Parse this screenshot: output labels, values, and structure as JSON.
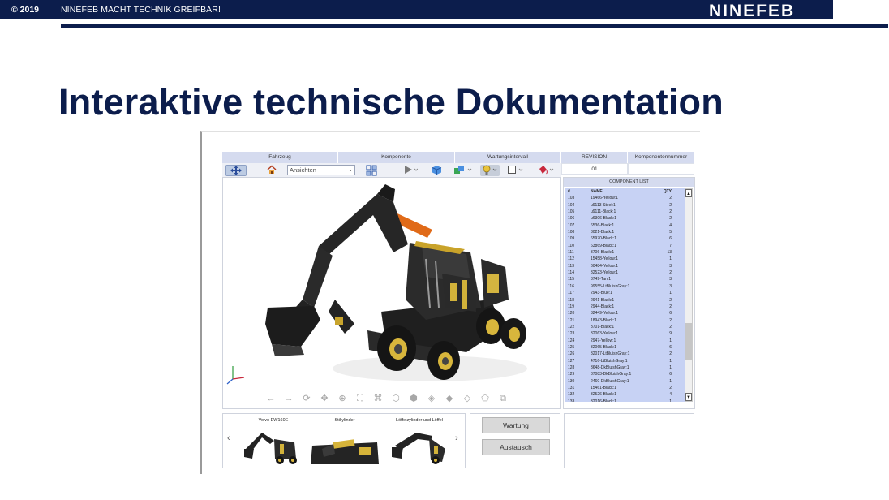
{
  "slide": {
    "copyright": "© 2019",
    "tagline": "NINEFEB MACHT TECHNIK GREIFBAR!",
    "logo": "NINEFEB",
    "title": "Interaktive technische Dokumentation"
  },
  "colors": {
    "navy": "#0c1d4c",
    "list_bg": "#c7d2f4",
    "header_bg": "#d5dbef"
  },
  "app": {
    "header_left": [
      "Fahrzeug",
      "Komponente",
      "Wartungsintervall"
    ],
    "header_right": {
      "revision_label": "REVISION",
      "revision_value": "01",
      "component_number_label": "Komponentennummer",
      "component_number_value": ""
    },
    "toolbar": {
      "views_select_value": "Ansichten",
      "icons": [
        "navigate-cube-icon",
        "home-icon",
        "explode-view-icon",
        "play-icon",
        "cube-icon",
        "colored-cubes-icon",
        "light-bulb-icon",
        "color-square-icon",
        "paint-bucket-icon"
      ]
    },
    "viewer_tools": [
      "arrow-left-icon",
      "arrow-right-icon",
      "rotate-icon",
      "pan-icon",
      "zoom-window-icon",
      "fit-all-icon",
      "select-tree-icon",
      "view-front-icon",
      "view-top-icon",
      "view-side-icon",
      "shaded-icon",
      "wireframe-icon",
      "hidden-line-icon",
      "section-icon"
    ],
    "component_list": {
      "title": "COMPONENT LIST",
      "columns": [
        "#",
        "NAME",
        "QTY"
      ],
      "rows": [
        [
          "103",
          "19466-Yellow:1",
          "2"
        ],
        [
          "104",
          "u9113-Steel:1",
          "2"
        ],
        [
          "105",
          "u9111-Black:1",
          "2"
        ],
        [
          "106",
          "u6306-Black:1",
          "2"
        ],
        [
          "107",
          "6536-Black:1",
          "4"
        ],
        [
          "108",
          "3021-Black:1",
          "5"
        ],
        [
          "109",
          "65970-Black:1",
          "6"
        ],
        [
          "110",
          "63869-Black:1",
          "7"
        ],
        [
          "111",
          "3706-Black:1",
          "13"
        ],
        [
          "112",
          "15458-Yellow:1",
          "1"
        ],
        [
          "113",
          "60484-Yellow:1",
          "3"
        ],
        [
          "114",
          "32523-Yellow:1",
          "2"
        ],
        [
          "115",
          "3749-Tan:1",
          "3"
        ],
        [
          "116",
          "99555-LtBluishGray:1",
          "3"
        ],
        [
          "117",
          "2943-Blue:1",
          "1"
        ],
        [
          "118",
          "2941-Black:1",
          "2"
        ],
        [
          "119",
          "2944-Black:1",
          "2"
        ],
        [
          "120",
          "32449-Yellow:1",
          "6"
        ],
        [
          "121",
          "18943-Black:1",
          "2"
        ],
        [
          "122",
          "3701-Black:1",
          "2"
        ],
        [
          "123",
          "32063-Yellow:1",
          "9"
        ],
        [
          "124",
          "2947-Yellow:1",
          "1"
        ],
        [
          "125",
          "32065-Black:1",
          "6"
        ],
        [
          "126",
          "32017-LtBluishGray:1",
          "2"
        ],
        [
          "127",
          "4716-LtBluishGray:1",
          "1"
        ],
        [
          "128",
          "3648-DkBluishGray:1",
          "1"
        ],
        [
          "129",
          "87083-DkBluishGray:1",
          "6"
        ],
        [
          "130",
          "2460-DkBluishGray:1",
          "1"
        ],
        [
          "131",
          "15461-Black:1",
          "2"
        ],
        [
          "132",
          "32526-Black:1",
          "4"
        ],
        [
          "133",
          "32016-Black:1",
          "1"
        ]
      ]
    },
    "thumbnails": [
      {
        "label": "Volvo EW160E"
      },
      {
        "label": "Stillylinder"
      },
      {
        "label": "Löffelzylinder und Löffel"
      }
    ],
    "actions": {
      "maintenance_label": "Wartung",
      "replace_label": "Austausch"
    }
  }
}
